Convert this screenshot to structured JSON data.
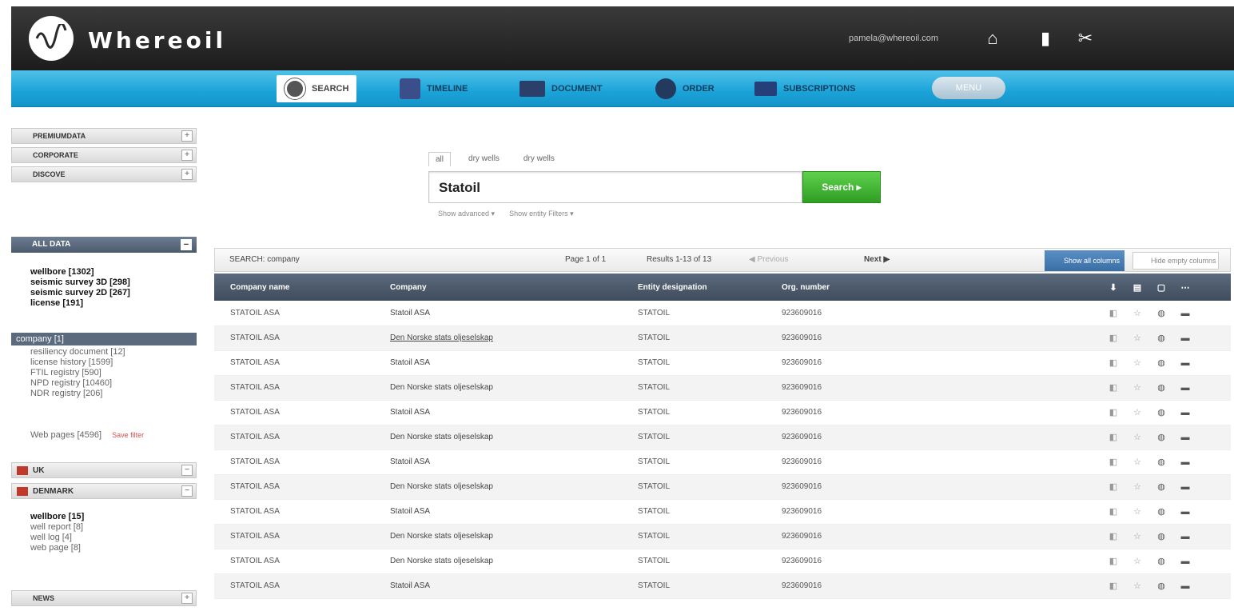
{
  "app": {
    "title": "Whereoil",
    "user_email": "pamela@whereoil.com"
  },
  "nav": {
    "items": [
      {
        "label": "SEARCH",
        "icon": "search-icon",
        "active": true
      },
      {
        "label": "TIMELINE",
        "icon": "home-icon"
      },
      {
        "label": "DOCUMENT",
        "icon": "document-icon"
      },
      {
        "label": "ORDER",
        "icon": "globe-icon"
      },
      {
        "label": "SUBSCRIPTIONS",
        "icon": "cart-icon"
      }
    ],
    "pill_label": "MENU"
  },
  "sidebar": {
    "headers": [
      "PREMIUMDATA",
      "CORPORATE",
      "DISCOVE"
    ],
    "section_label": "ALL DATA",
    "section_items": [
      {
        "label": "wellbore [1302]",
        "bold": true
      },
      {
        "label": "seismic survey 3D [298]",
        "bold": true
      },
      {
        "label": "seismic survey 2D [267]",
        "bold": true
      },
      {
        "label": "license [191]",
        "bold": true
      }
    ],
    "selected_item": "company [1]",
    "more_items": [
      "resiliency document [12]",
      "license history [1599]",
      "FTIL registry [590]",
      "NPD registry [10460]",
      "NDR registry [206]"
    ],
    "web_pages": "Web pages [4596]",
    "save_filter": "Save filter",
    "cat_uk": "UK",
    "cat_denmark": "DENMARK",
    "denmark_items": [
      {
        "label": "wellbore [15]",
        "bold": true
      },
      {
        "label": "well report [8]",
        "bold": false
      },
      {
        "label": "well log [4]",
        "bold": false
      },
      {
        "label": "web page [8]",
        "bold": false
      }
    ],
    "bottom_header": "NEWS"
  },
  "search": {
    "tabs": [
      "all",
      "dry wells",
      "dry wells"
    ],
    "query": "Statoil",
    "button_label": "Search",
    "options": [
      "Show advanced ▾",
      "Show entity Filters ▾"
    ]
  },
  "results": {
    "toolbar": {
      "search_label": "SEARCH: company",
      "page_info": "Page 1 of 1",
      "results_info": "Results 1-13 of 13",
      "prev_label": "◀ Previous",
      "next_label": "Next ▶",
      "show_columns": "Show all columns",
      "hide_columns": "Hide empty columns"
    },
    "columns": [
      "Company name",
      "Company",
      "Entity designation",
      "Org. number"
    ],
    "column_icons": [
      "download-icon",
      "print-icon",
      "share-icon",
      "more-icon"
    ],
    "rows": [
      {
        "name": "STATOIL ASA",
        "company": "Statoil ASA",
        "entity": "STATOIL",
        "org": "923609016"
      },
      {
        "name": "STATOIL ASA",
        "company": "Den Norske stats oljeselskap",
        "entity": "STATOIL",
        "org": "923609016"
      },
      {
        "name": "STATOIL ASA",
        "company": "Statoil ASA",
        "entity": "STATOIL",
        "org": "923609016"
      },
      {
        "name": "STATOIL ASA",
        "company": "Den Norske stats oljeselskap",
        "entity": "STATOIL",
        "org": "923609016"
      },
      {
        "name": "STATOIL ASA",
        "company": "Statoil ASA",
        "entity": "STATOIL",
        "org": "923609016"
      },
      {
        "name": "STATOIL ASA",
        "company": "Den Norske stats oljeselskap",
        "entity": "STATOIL",
        "org": "923609016"
      },
      {
        "name": "STATOIL ASA",
        "company": "Statoil ASA",
        "entity": "STATOIL",
        "org": "923609016"
      },
      {
        "name": "STATOIL ASA",
        "company": "Den Norske stats oljeselskap",
        "entity": "STATOIL",
        "org": "923609016"
      },
      {
        "name": "STATOIL ASA",
        "company": "Statoil ASA",
        "entity": "STATOIL",
        "org": "923609016"
      },
      {
        "name": "STATOIL ASA",
        "company": "Den Norske stats oljeselskap",
        "entity": "STATOIL",
        "org": "923609016"
      },
      {
        "name": "STATOIL ASA",
        "company": "Den Norske stats oljeselskap",
        "entity": "STATOIL",
        "org": "923609016"
      },
      {
        "name": "STATOIL ASA",
        "company": "Statoil ASA",
        "entity": "STATOIL",
        "org": "923609016"
      }
    ]
  },
  "colors": {
    "nav_accent": "#1aa3d8",
    "header_dark": "#2a2a2a",
    "table_header": "#4a5868",
    "search_button": "#3db82e"
  }
}
